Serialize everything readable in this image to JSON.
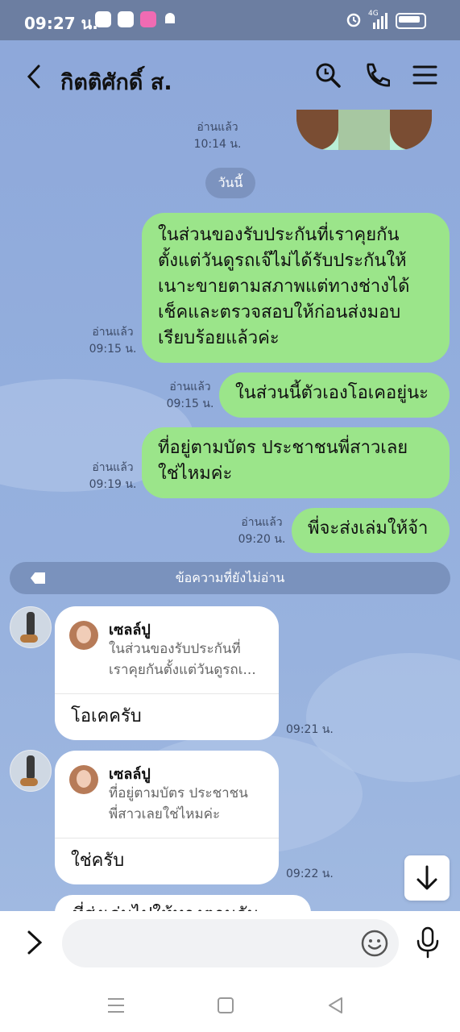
{
  "status_bar": {
    "time": "09:27 น.",
    "network": "4G"
  },
  "header": {
    "title": "กิตติศักดิ์ ส.",
    "icons": [
      "back-icon",
      "search-icon",
      "phone-icon",
      "menu-icon"
    ]
  },
  "messages_top": {
    "sticker_read": "อ่านแล้ว",
    "sticker_time": "10:14 น."
  },
  "date_divider": "วันนี้",
  "outgoing": [
    {
      "read": "อ่านแล้ว",
      "time": "09:15 น.",
      "lines": [
        "ในส่วนของรับประกันที่เราคุยกัน",
        "ตั้งแต่วันดูรถเจ๊ไม่ได้รับประกันให้",
        "เนาะขายตามสภาพแต่ทางช่างได้",
        "เช็คและตรวจสอบให้ก่อนส่งมอบ",
        "เรียบร้อยแล้วค่ะ"
      ]
    },
    {
      "read": "อ่านแล้ว",
      "time": "09:15 น.",
      "lines": [
        "ในส่วนนี้ตัวเองโอเคอยู่นะ"
      ]
    },
    {
      "read": "อ่านแล้ว",
      "time": "09:19 น.",
      "lines": [
        "ที่อยู่ตามบัตร ประชาชนพี่สาวเลย",
        "ใช่ไหมค่ะ"
      ]
    },
    {
      "read": "อ่านแล้ว",
      "time": "09:20 น.",
      "lines": [
        "พี่จะส่งเล่มให้จ้า"
      ]
    }
  ],
  "unread_divider": "ข้อความที่ยังไม่อ่าน",
  "incoming": [
    {
      "reply_name": "เซลล์ปู",
      "reply_lines": [
        "ในส่วนของรับประกันที่",
        "เราคุยกันตั้งแต่วันดูรถเ..."
      ],
      "text": "โอเคครับ",
      "time": "09:21 น."
    },
    {
      "reply_name": "เซลล์ปู",
      "reply_lines": [
        "ที่อยู่ตามบัตร ประชาชน",
        "พี่สาวเลยใช่ไหมค่ะ"
      ],
      "text": "ใช่ครับ",
      "time": "09:22 น."
    }
  ],
  "partial_message": "ที่ส่งเล่มไปให้ทางตามกัน",
  "input": {
    "placeholder": "",
    "value": ""
  },
  "colors": {
    "outgoing_bubble": "#9be58a",
    "incoming_bubble": "#ffffff",
    "chat_background": "#8fa9d9",
    "status_bar": "#6c7ea1"
  }
}
